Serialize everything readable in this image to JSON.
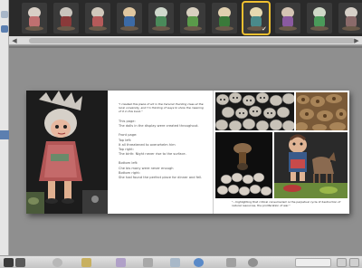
{
  "sidebar": {
    "icons": [
      "photo-icon",
      "book-icon"
    ]
  },
  "filmstrip": {
    "thumbnails": [
      {
        "head": "#d8cfc6",
        "body": "#c07070",
        "selected": false
      },
      {
        "head": "#c9c4bd",
        "body": "#8a3a3a",
        "selected": false
      },
      {
        "head": "#d0c8bc",
        "body": "#b55a5a",
        "selected": false
      },
      {
        "head": "#e0c7a0",
        "body": "#3c6aa5",
        "selected": false
      },
      {
        "head": "#cfd8cc",
        "body": "#4a8a5a",
        "selected": false
      },
      {
        "head": "#d8d0c0",
        "body": "#5a9a4a",
        "selected": false
      },
      {
        "head": "#e0d0b0",
        "body": "#3a7a3a",
        "selected": false
      },
      {
        "head": "#e6d8b0",
        "body": "#4a8a8a",
        "selected": true
      },
      {
        "head": "#d4c4b4",
        "body": "#8a5aa0",
        "selected": false
      },
      {
        "head": "#d0d8c8",
        "body": "#4a9a5a",
        "selected": false
      },
      {
        "head": "#d6d0c8",
        "body": "#8a6a6a",
        "selected": false
      }
    ]
  },
  "book": {
    "left_text": {
      "quote": "\"I created this piece of art in the Ceramic Painting class at the local university, and I'm thinking of ways to show the meaning of it in this book.\"",
      "paragraphs": [
        "This page:\nThe dolls in the display were created throughout.",
        "Front page:\nTop left:\nIt all threatened to overwhelm him\nTop right:\nThe birth: Night never rise to the surface.",
        "Bottom left:\nChe bis many were never enough\nBottom right:\nShe had found the perfect place for dinner and fell."
      ]
    },
    "caption": "\"...highlighting that critical consumerism is the perpetual cycle of destruction of natural resources, the proliferation of war.\""
  },
  "toolbar": {
    "buttons": [
      "grid-view-icon",
      "spread-view-icon",
      "play-icon",
      "theme-icon",
      "layout-icon",
      "edit-icon",
      "rotate-icon",
      "publish-icon",
      "settings-icon",
      "share-icon"
    ]
  },
  "colors": {
    "filmstrip_bg": "#2a2a2a",
    "selection": "#f0c030",
    "canvas_bg": "#8f8f8f"
  }
}
